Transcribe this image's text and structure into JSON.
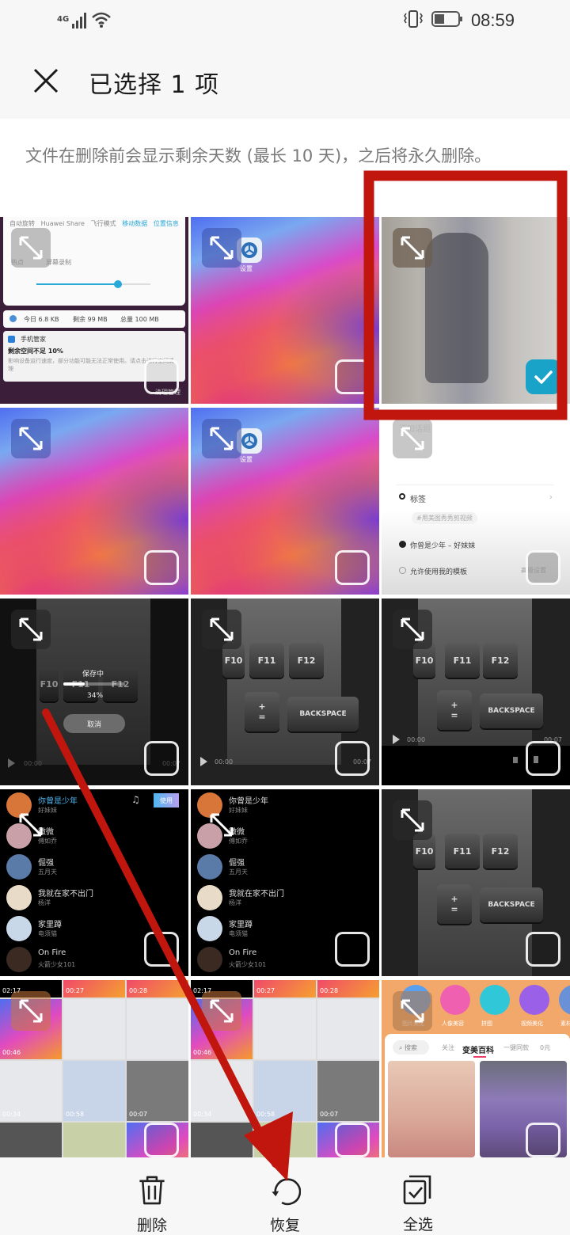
{
  "status_bar": {
    "network": "4G",
    "time": "08:59",
    "icons": [
      "signal-icon",
      "wifi-icon",
      "vibrate-icon",
      "battery-icon"
    ]
  },
  "header": {
    "close_icon": "close-icon",
    "title": "已选择 1 项"
  },
  "notice": {
    "text": "文件在删除前会显示剩余天数 (最长 10 天)，之后将永久删除。"
  },
  "grid": {
    "items": [
      {
        "type": "screenshot",
        "selected": false,
        "content": {
          "quick_toggles": [
            "自动旋转",
            "Huawei Share",
            "飞行模式",
            "移动数据",
            "位置信息"
          ],
          "toggle_row2": [
            "热点",
            "屏幕录制"
          ],
          "data_usage": {
            "today": "今日 6.8 KB",
            "remaining": "剩余 99 MB",
            "total": "总量 100 MB"
          },
          "notification_app": "手机管家",
          "notification_title": "剩余空间不足 10%",
          "notification_body": "影响设备运行速度，部分功能可能无法正常使用。请点击进行空间清理",
          "notification_action": "清理管理"
        }
      },
      {
        "type": "screenshot",
        "selected": false,
        "content": {
          "app_label": "设置"
        }
      },
      {
        "type": "video",
        "selected": true,
        "content": {}
      },
      {
        "type": "screenshot",
        "selected": false,
        "content": {}
      },
      {
        "type": "screenshot",
        "selected": false,
        "content": {
          "app_label": "设置"
        }
      },
      {
        "type": "screenshot",
        "selected": false,
        "content": {
          "top_text": "添加话题",
          "tag_label": "标签",
          "tag_chip": "#用美图秀秀剪视频",
          "music": "你曾是少年 – 好妹妹",
          "template_option": "允许使用我的模板",
          "advanced": "高级设置"
        }
      },
      {
        "type": "video",
        "selected": false,
        "content": {
          "saving_label": "保存中",
          "progress": 0.34,
          "progress_text": "34%",
          "cancel_label": "取消",
          "time_start": "00:00",
          "time_end": "00:07"
        }
      },
      {
        "type": "video",
        "selected": false,
        "content": {
          "keys": [
            "F11",
            "F12",
            "BACKSPACE"
          ],
          "time_start": "00:00",
          "time_end": "00:07"
        }
      },
      {
        "type": "video",
        "selected": false,
        "content": {
          "keys": [
            "F11",
            "F12",
            "BACKSPACE"
          ],
          "time_start": "00:00",
          "time_end": "00:07"
        }
      },
      {
        "type": "screenshot",
        "selected": false,
        "content": {
          "use_button": "使用",
          "songs": [
            {
              "title": "你曾是少年",
              "artist": "好妹妹"
            },
            {
              "title": "微微",
              "artist": "傅如乔"
            },
            {
              "title": "倔强",
              "artist": "五月天"
            },
            {
              "title": "我就在家不出门",
              "artist": "杨洋"
            },
            {
              "title": "家里蹲",
              "artist": "电须猫"
            },
            {
              "title": "On Fire",
              "artist": "火箭少女101"
            }
          ]
        }
      },
      {
        "type": "screenshot",
        "selected": false,
        "content": {
          "songs": [
            {
              "title": "你曾是少年",
              "artist": "好妹妹"
            },
            {
              "title": "微微",
              "artist": "傅如乔"
            },
            {
              "title": "倔强",
              "artist": "五月天"
            },
            {
              "title": "我就在家不出门",
              "artist": "杨洋"
            },
            {
              "title": "家里蹲",
              "artist": "电须猫"
            },
            {
              "title": "On Fire",
              "artist": "火箭少女101"
            }
          ]
        }
      },
      {
        "type": "video",
        "selected": false,
        "content": {}
      },
      {
        "type": "screenshot",
        "selected": false,
        "content": {
          "durations": [
            "02:17",
            "00:27",
            "00:28",
            "00:46",
            "00:34",
            "00:58",
            "00:07"
          ]
        }
      },
      {
        "type": "screenshot",
        "selected": false,
        "content": {
          "durations": [
            "02:17",
            "00:27",
            "00:28",
            "00:46",
            "00:34",
            "00:58",
            "00:07"
          ]
        }
      },
      {
        "type": "screenshot",
        "selected": false,
        "content": {
          "shortcuts": [
            "图片美化",
            "人像美容",
            "拼图",
            "视频美化",
            "素材"
          ],
          "search_placeholder": "搜索",
          "tabs": [
            "关注",
            "变美百科",
            "一键同款",
            "0元"
          ],
          "active_tab": "变美百科"
        }
      }
    ]
  },
  "bottom_bar": {
    "actions": [
      {
        "label": "删除",
        "icon": "trash-icon"
      },
      {
        "label": "恢复",
        "icon": "restore-icon"
      },
      {
        "label": "全选",
        "icon": "select-all-icon"
      }
    ]
  },
  "colors": {
    "accent": "#1aa3c8",
    "annotation": "#c0160e"
  }
}
